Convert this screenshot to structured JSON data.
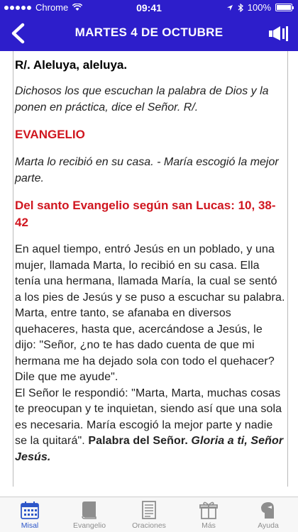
{
  "status": {
    "carrier": "Chrome",
    "time": "09:41",
    "battery": "100%"
  },
  "nav": {
    "title": "MARTES 4 DE OCTUBRE",
    "back_icon": "chevron-left-icon",
    "speaker_icon": "speaker-icon"
  },
  "colors": {
    "header": "#2d1ecb",
    "red": "#d0161f",
    "tab_active": "#2d56c8",
    "tab_inactive": "#8e8e8e"
  },
  "reading": {
    "response": "R/. Aleluya, aleluya.",
    "verse": "Dichosos los que escuchan la palabra de Dios y la ponen en práctica, dice el Señor. R/.",
    "section": "EVANGELIO",
    "summary": "Marta lo recibió en su casa. - María escogió la mejor parte.",
    "source": "Del santo Evangelio según san Lucas: 10, 38-42",
    "paragraph1": "En aquel tiempo, entró Jesús en un poblado, y una mujer, llamada Marta, lo recibió en su casa. Ella tenía una hermana, llamada María, la cual se sentó a los pies de Jesús y se puso a escuchar su palabra. Marta, entre tanto, se afanaba en diversos quehaceres, hasta que, acercándose a Jesús, le dijo: \"Señor, ¿no te has dado cuenta de que mi hermana me ha dejado sola con todo el quehacer? Dile que me ayude\".",
    "paragraph2": "El Señor le respondió: \"Marta, Marta, muchas cosas te preocupan y te inquietan, siendo así que una sola es necesaria. María escogió la mejor parte y nadie se la quitará\".",
    "closing": "Palabra del Señor.",
    "closing_response": "Gloria a ti, Señor Jesús."
  },
  "tabs": [
    {
      "label": "Misal",
      "icon": "calendar-icon"
    },
    {
      "label": "Evangelio",
      "icon": "book-icon"
    },
    {
      "label": "Oraciones",
      "icon": "document-icon"
    },
    {
      "label": "Más",
      "icon": "gift-icon"
    },
    {
      "label": "Ayuda",
      "icon": "help-icon"
    }
  ]
}
